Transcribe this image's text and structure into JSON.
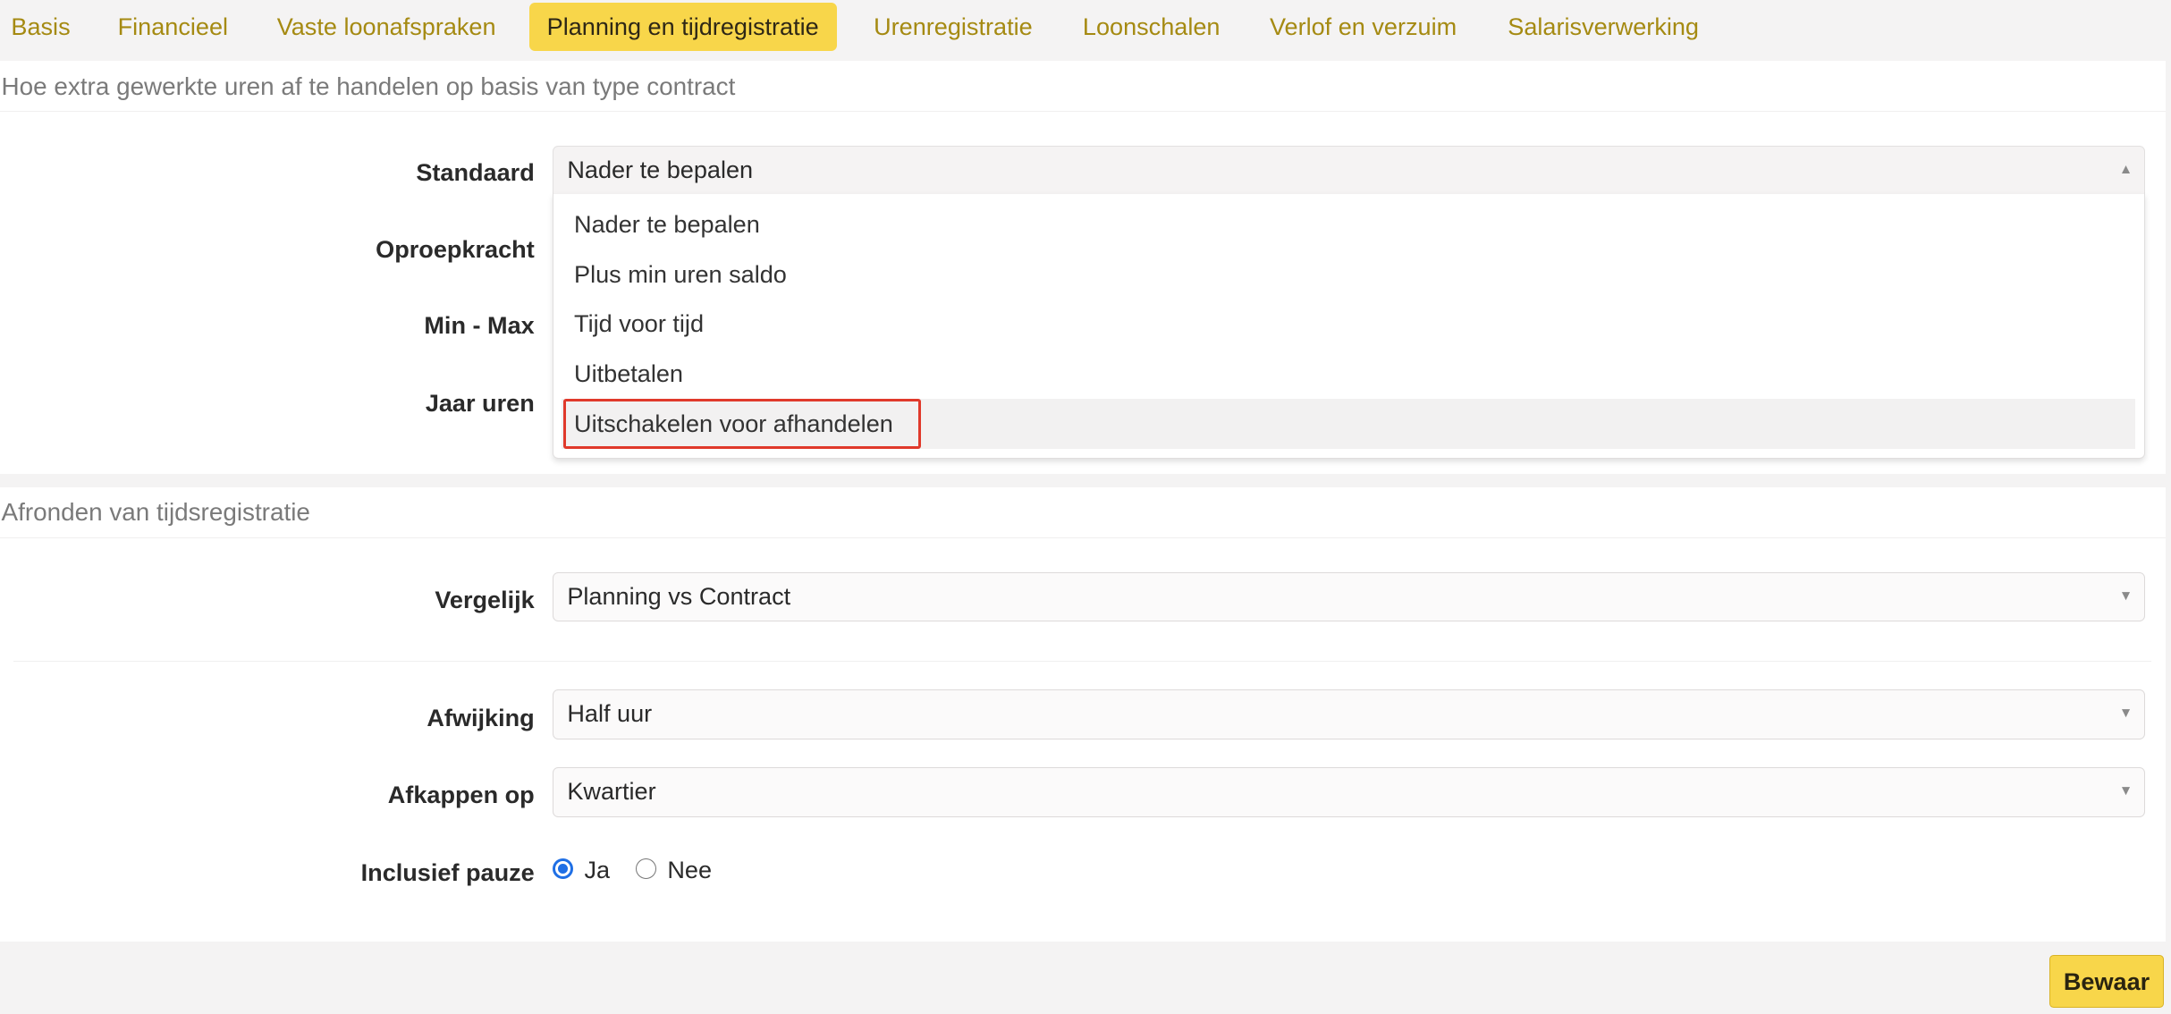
{
  "tabs": [
    {
      "label": "Basis",
      "active": false
    },
    {
      "label": "Financieel",
      "active": false
    },
    {
      "label": "Vaste loonafspraken",
      "active": false
    },
    {
      "label": "Planning en tijdregistratie",
      "active": true
    },
    {
      "label": "Urenregistratie",
      "active": false
    },
    {
      "label": "Loonschalen",
      "active": false
    },
    {
      "label": "Verlof en verzuim",
      "active": false
    },
    {
      "label": "Salarisverwerking",
      "active": false
    }
  ],
  "section1": {
    "title": "Hoe extra gewerkte uren af te handelen op basis van type contract",
    "fields": [
      {
        "label": "Standaard",
        "value": "Nader te bepalen"
      },
      {
        "label": "Oproepkracht"
      },
      {
        "label": "Min - Max"
      },
      {
        "label": "Jaar uren"
      }
    ],
    "dropdown_options": [
      "Nader te bepalen",
      "Plus min uren saldo",
      "Tijd voor tijd",
      "Uitbetalen",
      "Uitschakelen voor afhandelen"
    ]
  },
  "section2": {
    "title": "Afronden van tijdsregistratie",
    "vergelijk": {
      "label": "Vergelijk",
      "value": "Planning vs Contract"
    },
    "afwijking": {
      "label": "Afwijking",
      "value": "Half uur"
    },
    "afkappen": {
      "label": "Afkappen op",
      "value": "Kwartier"
    },
    "pauze": {
      "label": "Inclusief pauze",
      "options": [
        "Ja",
        "Nee"
      ],
      "selected": "Ja"
    }
  },
  "save_label": "Bewaar",
  "colors": {
    "accent": "#f8d64a",
    "tab_text": "#a58a12",
    "highlight": "#e0392b",
    "radio": "#1f6fe5"
  }
}
